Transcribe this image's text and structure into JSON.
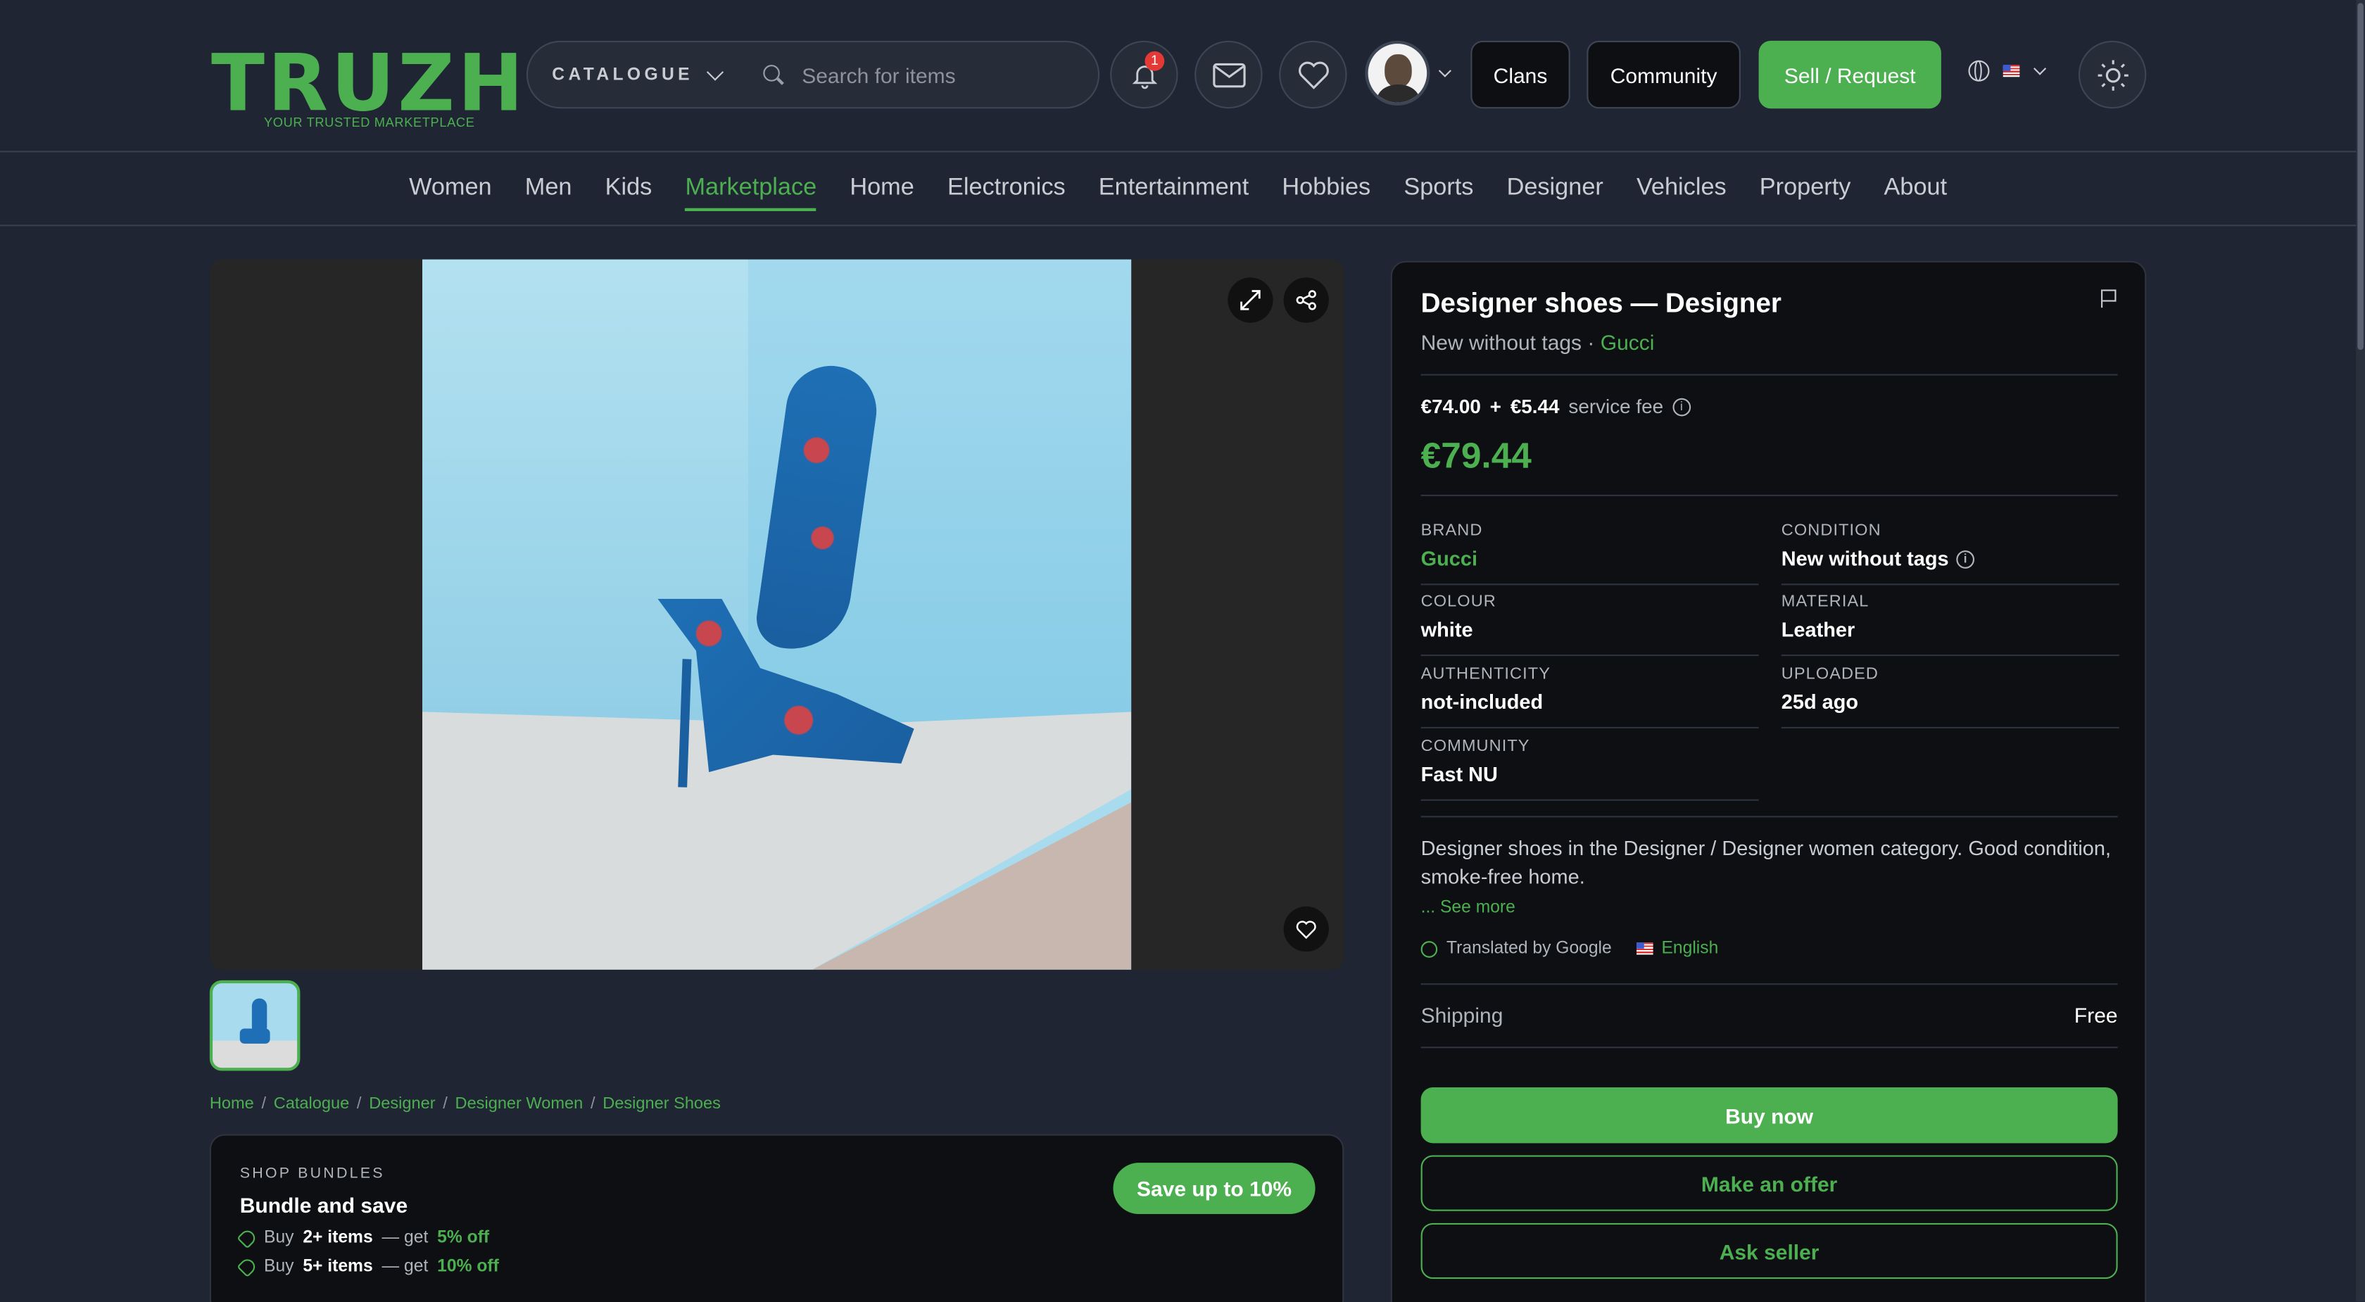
{
  "header": {
    "logo_text": "TRUZH",
    "logo_tagline": "YOUR TRUSTED MARKETPLACE",
    "catalogue_label": "CATALOGUE",
    "search_placeholder": "Search for items",
    "notifications_count": "1",
    "clans_label": "Clans",
    "community_label": "Community",
    "sell_label": "Sell / Request"
  },
  "nav": {
    "items": [
      "Women",
      "Men",
      "Kids",
      "Marketplace",
      "Home",
      "Electronics",
      "Entertainment",
      "Hobbies",
      "Sports",
      "Designer",
      "Vehicles",
      "Property",
      "About"
    ],
    "active": "Marketplace"
  },
  "breadcrumb": [
    "Home",
    "Catalogue",
    "Designer",
    "Designer Women",
    "Designer Shoes"
  ],
  "bundles": {
    "label": "SHOP BUNDLES",
    "title": "Bundle and save",
    "save_button": "Save up to 10%",
    "tiers": [
      {
        "buy": "Buy",
        "qty": "2+ items",
        "mid": "— get",
        "off": "5% off"
      },
      {
        "buy": "Buy",
        "qty": "5+ items",
        "mid": "— get",
        "off": "10% off"
      }
    ]
  },
  "product": {
    "title": "Designer shoes — Designer",
    "condition_line": "New without tags ·",
    "brand_link": "Gucci",
    "price": "€74.00",
    "plus": "+",
    "fee": "€5.44",
    "fee_label": "service fee",
    "total": "€79.44",
    "attributes": {
      "brand": {
        "label": "BRAND",
        "value": "Gucci"
      },
      "condition": {
        "label": "CONDITION",
        "value": "New without tags"
      },
      "colour": {
        "label": "COLOUR",
        "value": "white"
      },
      "material": {
        "label": "MATERIAL",
        "value": "Leather"
      },
      "authenticity": {
        "label": "AUTHENTICITY",
        "value": "not-included"
      },
      "uploaded": {
        "label": "UPLOADED",
        "value": "25d ago"
      },
      "community": {
        "label": "COMMUNITY",
        "value": "Fast NU"
      }
    },
    "description": "Designer shoes in the Designer / Designer women category. Good condition, smoke-free home.",
    "see_more": "... See more",
    "translated_by": "Translated by Google",
    "language": "English",
    "shipping_label": "Shipping",
    "shipping_value": "Free",
    "buy_now": "Buy now",
    "make_offer": "Make an offer",
    "ask_seller": "Ask seller"
  },
  "colors": {
    "accent": "#4caf50",
    "background": "#1f2533",
    "panel": "#0d0f12"
  }
}
